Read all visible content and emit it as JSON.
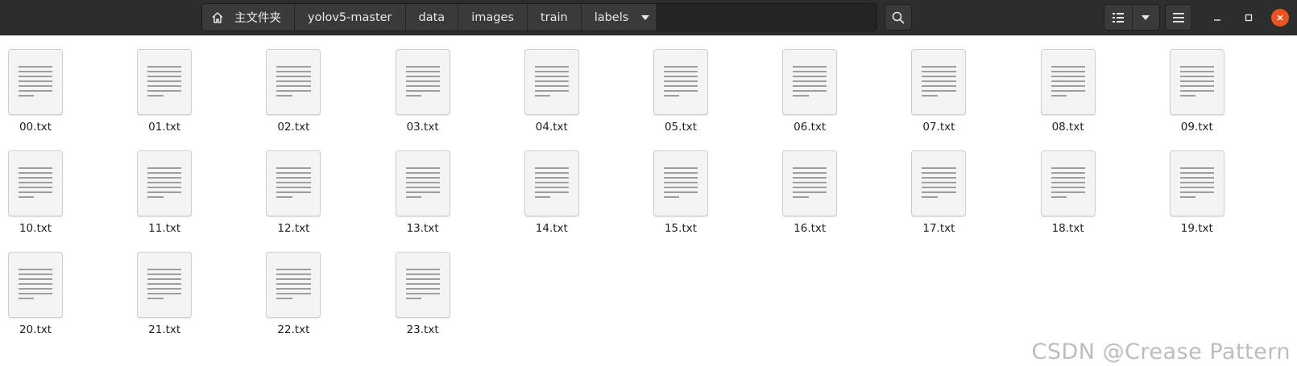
{
  "pathbar": {
    "home_label": "主文件夹",
    "crumbs": [
      "yolov5-master",
      "data",
      "images",
      "train"
    ],
    "current": "labels"
  },
  "icons": {
    "home": "home-icon",
    "search": "search-icon",
    "view_list": "list-view-icon",
    "view_options": "chevron-down-icon",
    "menu": "hamburger-menu-icon",
    "minimize": "minimize-icon",
    "maximize": "maximize-icon",
    "close": "close-icon"
  },
  "colors": {
    "headerbar": "#2d2d2d",
    "close_button": "#e95420",
    "background": "#ffffff"
  },
  "files": [
    "00.txt",
    "01.txt",
    "02.txt",
    "03.txt",
    "04.txt",
    "05.txt",
    "06.txt",
    "07.txt",
    "08.txt",
    "09.txt",
    "10.txt",
    "11.txt",
    "12.txt",
    "13.txt",
    "14.txt",
    "15.txt",
    "16.txt",
    "17.txt",
    "18.txt",
    "19.txt",
    "20.txt",
    "21.txt",
    "22.txt",
    "23.txt"
  ],
  "watermark": "CSDN @Crease Pattern"
}
